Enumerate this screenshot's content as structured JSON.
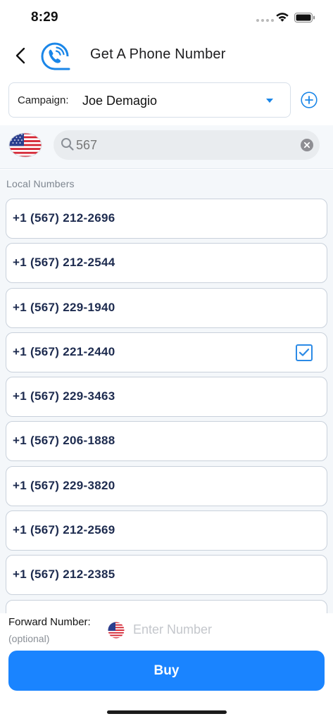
{
  "status_bar": {
    "time": "8:29"
  },
  "header": {
    "title": "Get A Phone Number"
  },
  "campaign": {
    "label": "Campaign:",
    "value": "Joe Demagio"
  },
  "search": {
    "query": "567"
  },
  "list": {
    "section_label": "Local Numbers",
    "numbers": [
      {
        "number": "+1 (567) 212-2696",
        "selected": false
      },
      {
        "number": "+1 (567) 212-2544",
        "selected": false
      },
      {
        "number": "+1 (567) 229-1940",
        "selected": false
      },
      {
        "number": "+1 (567) 221-2440",
        "selected": true
      },
      {
        "number": "+1 (567) 229-3463",
        "selected": false
      },
      {
        "number": "+1 (567) 206-1888",
        "selected": false
      },
      {
        "number": "+1 (567) 229-3820",
        "selected": false
      },
      {
        "number": "+1 (567) 212-2569",
        "selected": false
      },
      {
        "number": "+1 (567) 212-2385",
        "selected": false
      },
      {
        "number": "",
        "selected": false
      }
    ]
  },
  "forward": {
    "label": "Forward Number:",
    "optional": "(optional)",
    "placeholder": "Enter Number",
    "value": ""
  },
  "buy_button": {
    "label": "Buy"
  },
  "icons": {
    "back": "chevron-left-icon",
    "logo": "phone-call-icon",
    "caret": "caret-down-icon",
    "add": "plus-circle-icon",
    "flag": "us-flag-icon",
    "search": "search-icon",
    "clear": "clear-icon",
    "check": "checkbox-checked-icon"
  },
  "colors": {
    "accent": "#1a84ff",
    "number_text": "#1d2b4f",
    "list_background": "#f4f7fa"
  }
}
